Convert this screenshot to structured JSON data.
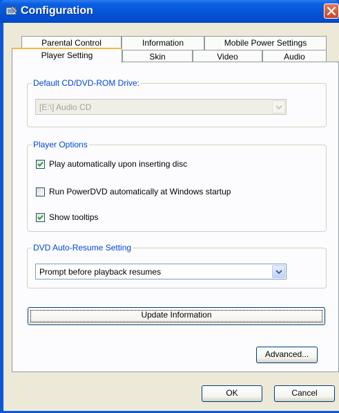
{
  "window": {
    "title": "Configuration"
  },
  "tabs": {
    "row_back": [
      "Parental Control",
      "Information",
      "Mobile Power Settings"
    ],
    "row_front": [
      "Player Setting",
      "Skin",
      "Video",
      "Audio"
    ],
    "active": "Player Setting"
  },
  "cd_drive": {
    "legend": "Default CD/DVD-ROM Drive:",
    "value": "[E:\\] Audio CD",
    "enabled": false
  },
  "player_options": {
    "legend": "Player Options",
    "items": [
      {
        "label": "Play automatically upon inserting disc",
        "checked": true
      },
      {
        "label": "Run PowerDVD automatically at Windows startup",
        "checked": false
      },
      {
        "label": "Show tooltips",
        "checked": true
      }
    ]
  },
  "auto_resume": {
    "legend": "DVD Auto-Resume Setting",
    "value": "Prompt before playback resumes"
  },
  "buttons": {
    "update": "Update Information",
    "advanced": "Advanced...",
    "ok": "OK",
    "cancel": "Cancel"
  },
  "colors": {
    "titlebar": "#0453d6",
    "legend": "#0046d5",
    "active_tab_accent": "#f8b53b",
    "dialog_bg": "#ece9d8"
  },
  "icons": {
    "title": "config-app-icon",
    "close": "close-icon",
    "dropdown": "chevron-down-icon",
    "check": "checkmark-icon"
  }
}
